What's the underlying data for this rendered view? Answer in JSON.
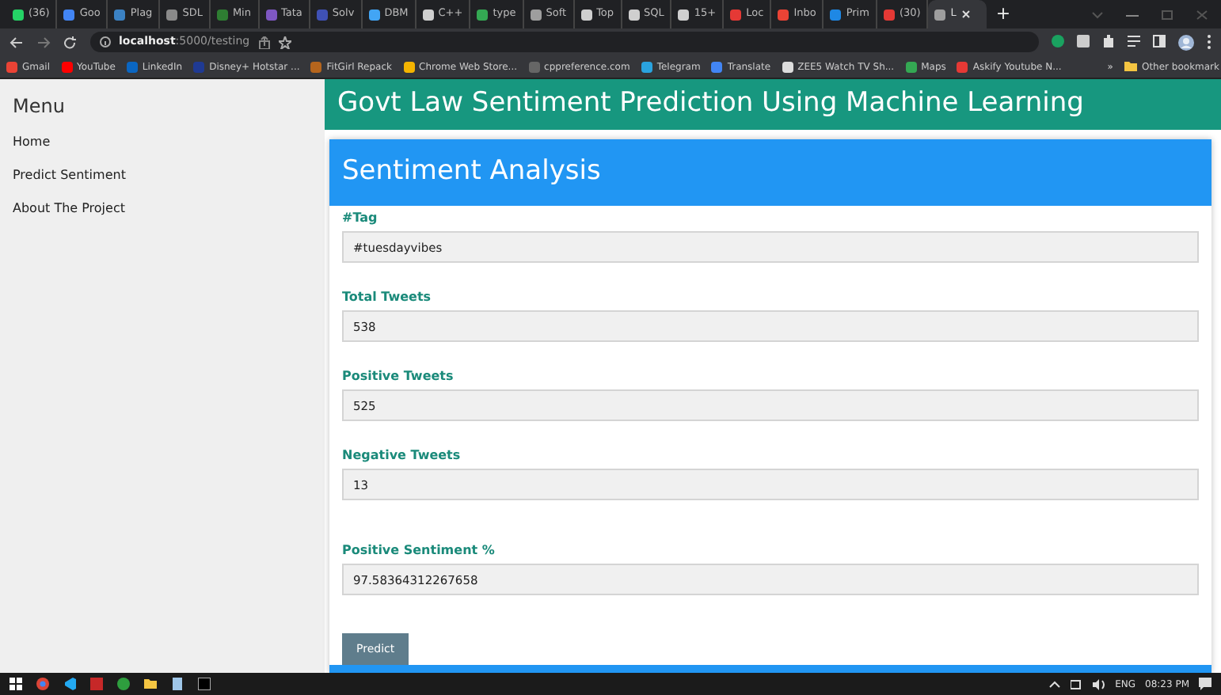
{
  "browser": {
    "tabs": [
      {
        "label": "(36)",
        "color": "#25d366",
        "selected": false
      },
      {
        "label": "Goo",
        "color": "#4285f4",
        "selected": false
      },
      {
        "label": "Plag",
        "color": "#3b82c4",
        "selected": false
      },
      {
        "label": "SDL",
        "color": "#8a8a8a",
        "selected": false
      },
      {
        "label": "Min",
        "color": "#2e7d32",
        "selected": false
      },
      {
        "label": "Tata",
        "color": "#7e57c2",
        "selected": false
      },
      {
        "label": "Solv",
        "color": "#3f51b5",
        "selected": false
      },
      {
        "label": "DBM",
        "color": "#42a5f5",
        "selected": false
      },
      {
        "label": "C++",
        "color": "#cfcfcf",
        "selected": false
      },
      {
        "label": "type",
        "color": "#34a853",
        "selected": false
      },
      {
        "label": "Soft",
        "color": "#9e9e9e",
        "selected": false
      },
      {
        "label": "Top",
        "color": "#cfcfcf",
        "selected": false
      },
      {
        "label": "SQL",
        "color": "#cfcfcf",
        "selected": false
      },
      {
        "label": "15+",
        "color": "#cfcfcf",
        "selected": false
      },
      {
        "label": "Loc",
        "color": "#e53935",
        "selected": false
      },
      {
        "label": "Inbo",
        "color": "#ea4335",
        "selected": false
      },
      {
        "label": "Prim",
        "color": "#1e88e5",
        "selected": false
      },
      {
        "label": "(30)",
        "color": "#e53935",
        "selected": false
      },
      {
        "label": "L",
        "color": "#9e9e9e",
        "selected": true
      }
    ],
    "new_tab": "+",
    "address": "**localhost**:5000/testing",
    "bookmarks": [
      {
        "label": "Gmail",
        "color": "#ea4335"
      },
      {
        "label": "YouTube",
        "color": "#ff0000"
      },
      {
        "label": "LinkedIn",
        "color": "#0a66c2"
      },
      {
        "label": "Disney+ Hotstar ...",
        "color": "#1f3a93"
      },
      {
        "label": "FitGirl Repack",
        "color": "#b5651d"
      },
      {
        "label": "Chrome Web Store...",
        "color": "#f4b400"
      },
      {
        "label": "cppreference.com",
        "color": "#666666"
      },
      {
        "label": "Telegram",
        "color": "#2aa3df"
      },
      {
        "label": "Translate",
        "color": "#4285f4"
      },
      {
        "label": "ZEE5 Watch TV Sh...",
        "color": "#dddddd"
      },
      {
        "label": "Maps",
        "color": "#34a853"
      },
      {
        "label": "Askify Youtube N...",
        "color": "#e53935"
      }
    ],
    "more_bookmarks": "»",
    "other_bookmarks": "Other bookmark"
  },
  "sidebar": {
    "title": "Menu",
    "items": [
      "Home",
      "Predict Sentiment",
      "About The Project"
    ]
  },
  "header": "Govt Law Sentiment Prediction Using Machine Learning",
  "card": {
    "title": "Sentiment Analysis",
    "fields": [
      {
        "label": "#Tag",
        "value": "#tuesdayvibes"
      },
      {
        "label": "Total Tweets",
        "value": "538"
      },
      {
        "label": "Positive Tweets",
        "value": "525"
      },
      {
        "label": "Negative Tweets",
        "value": "13"
      },
      {
        "label": "Positive Sentiment %",
        "value": "97.58364312267658"
      }
    ],
    "button": "Predict"
  },
  "taskbar": {
    "language": "ENG",
    "time": "08:23 PM"
  }
}
